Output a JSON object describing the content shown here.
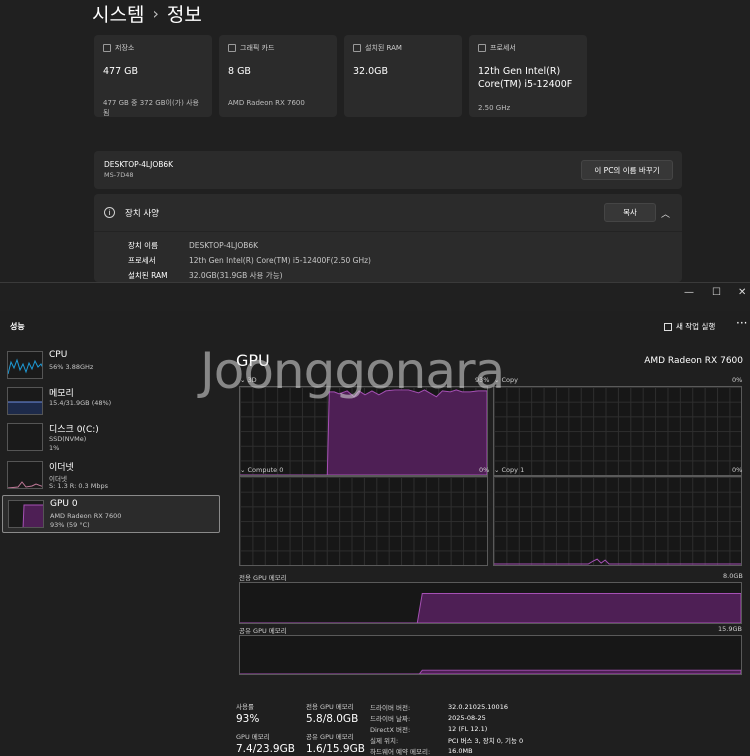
{
  "settings": {
    "breadcrumb": {
      "parent": "시스템",
      "separator": "›",
      "current": "정보"
    },
    "cards": [
      {
        "icon": "storage-icon",
        "label": "저장소",
        "value": "477 GB",
        "sub": "477 GB 중 372 GB이(가) 사용됨"
      },
      {
        "icon": "graphics-card-icon",
        "label": "그래픽 카드",
        "value": "8 GB",
        "sub": "AMD Radeon RX 7600"
      },
      {
        "icon": "ram-icon",
        "label": "설치된 RAM",
        "value": "32.0GB",
        "sub": ""
      },
      {
        "icon": "processor-icon",
        "label": "프로세서",
        "value": "12th Gen Intel(R) Core(TM) i5-12400F",
        "sub": "2.50 GHz"
      }
    ],
    "pc": {
      "name": "DESKTOP-4LJOB6K",
      "model": "MS-7D48",
      "rename_button": "이 PC의 이름 바꾸기"
    },
    "device_specs": {
      "title": "장치 사양",
      "copy_button": "복사",
      "rows": [
        {
          "key": "장치 이름",
          "value": "DESKTOP-4LJOB6K"
        },
        {
          "key": "프로세서",
          "value": "12th Gen Intel(R) Core(TM) i5-12400F(2.50 GHz)"
        },
        {
          "key": "설치된 RAM",
          "value": "32.0GB(31.9GB 사용 가능)"
        }
      ]
    }
  },
  "taskmanager": {
    "window_controls": {
      "minimize": "—",
      "maximize": "☐",
      "close": "✕"
    },
    "section_title": "성능",
    "new_task_button": "새 작업 실행",
    "more_button": "···",
    "sidebar": [
      {
        "name": "CPU",
        "detail1": "56% 3.88GHz",
        "detail2": ""
      },
      {
        "name": "메모리",
        "detail1": "15.4/31.9GB (48%)",
        "detail2": ""
      },
      {
        "name": "디스크 0(C:)",
        "detail1": "SSD(NVMe)",
        "detail2": "1%"
      },
      {
        "name": "이더넷",
        "detail1": "이더넷",
        "detail2": "S: 1.3 R: 0.3 Mbps"
      },
      {
        "name": "GPU 0",
        "detail1": "AMD Radeon RX 7600",
        "detail2": "93% (59 °C)"
      }
    ],
    "gpu": {
      "title": "GPU",
      "device": "AMD Radeon RX 7600",
      "engines": [
        {
          "label": "3D",
          "percent": "93%"
        },
        {
          "label": "Copy",
          "percent": "0%"
        },
        {
          "label": "Compute 0",
          "percent": "0%"
        },
        {
          "label": "Copy 1",
          "percent": "0%"
        }
      ],
      "dedicated_memory": {
        "label": "전용 GPU 메모리",
        "max": "8.0GB"
      },
      "shared_memory": {
        "label": "공유 GPU 메모리",
        "max": "15.9GB"
      },
      "stats": {
        "utilization": {
          "label": "사용률",
          "value": "93%"
        },
        "dedicated": {
          "label": "전용 GPU 메모리",
          "value": "5.8/8.0GB"
        },
        "gpu_memory": {
          "label": "GPU 메모리",
          "value": "7.4/23.9GB"
        },
        "shared": {
          "label": "공유 GPU 메모리",
          "value": "1.6/15.9GB"
        }
      },
      "details": [
        {
          "key": "드라이버 버전:",
          "value": "32.0.21025.10016"
        },
        {
          "key": "드라이버 날짜:",
          "value": "2025-08-25"
        },
        {
          "key": "DirectX 버전:",
          "value": "12 (FL 12.1)"
        },
        {
          "key": "실제 위치:",
          "value": "PCI 버스 3, 장치 0, 기능 0"
        },
        {
          "key": "하드웨어 예약 메모리:",
          "value": "16.0MB"
        }
      ]
    },
    "colors": {
      "gpu": "#a550b4",
      "cpu": "#1e9bd7",
      "memory": "#6f8fe3",
      "ethernet": "#c27a9a"
    }
  },
  "watermark": "Joonggonara"
}
